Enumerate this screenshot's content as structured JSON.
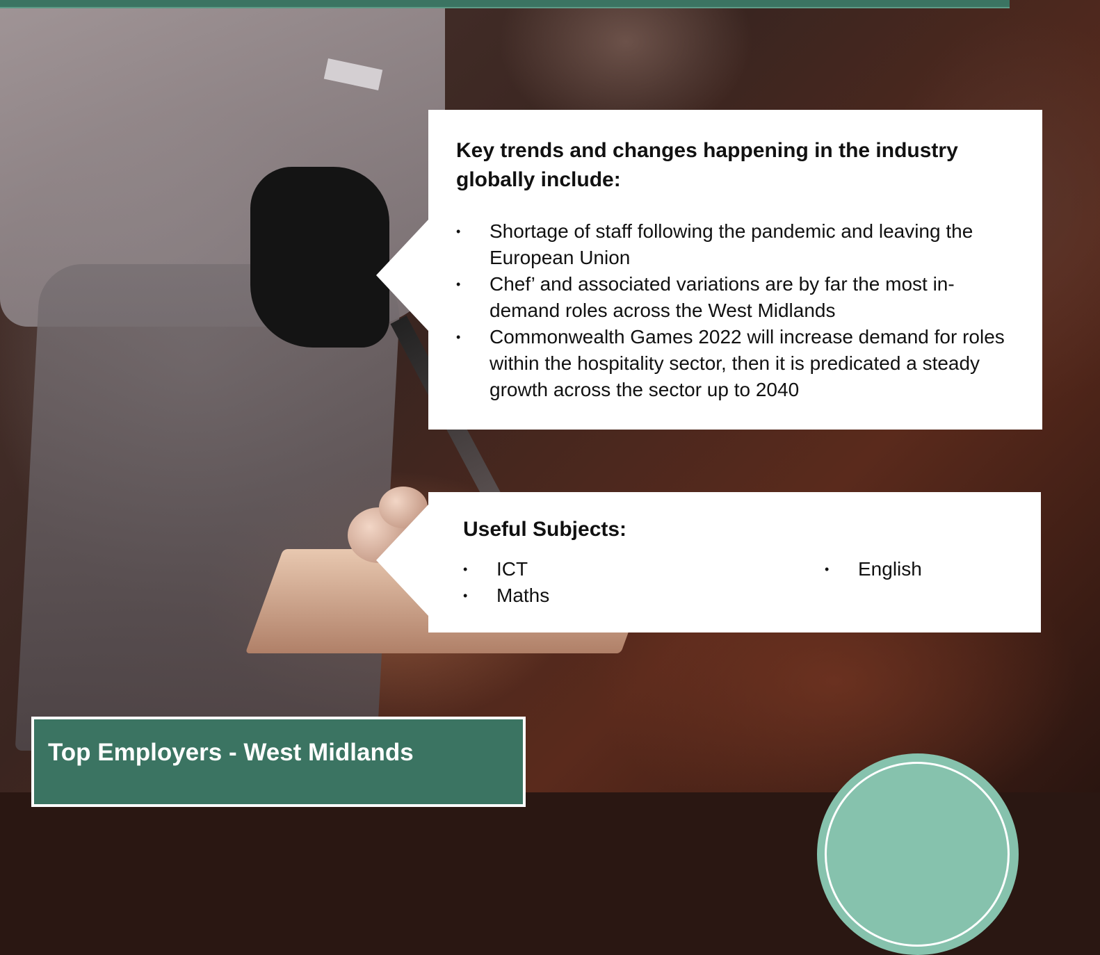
{
  "trends": {
    "title": "Key trends and changes happening in the industry globally include:",
    "items": [
      "Shortage of staff following the pandemic and leaving the European Union",
      "Chef’ and associated variations are by far the most in-demand roles across the West Midlands",
      "Commonwealth Games 2022 will increase demand for roles within the hospitality sector, then it is predicated a steady growth across the sector up to 2040"
    ]
  },
  "subjects": {
    "title": "Useful Subjects:",
    "column_one": [
      "ICT",
      "Maths"
    ],
    "column_two": [
      "English"
    ]
  },
  "employers": {
    "title": "Top Employers - West Midlands"
  },
  "colors": {
    "brand_green": "#3b7462",
    "accent_mint": "#86c2ad"
  }
}
